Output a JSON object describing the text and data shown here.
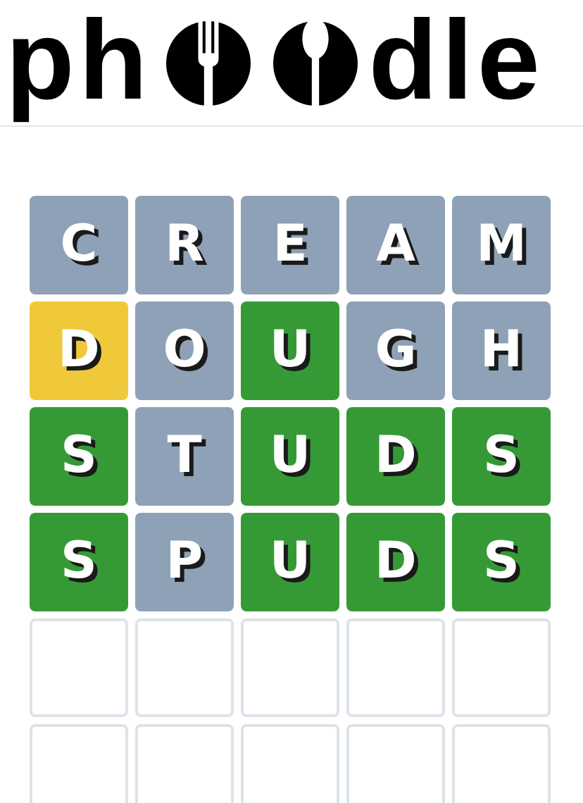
{
  "logo": {
    "prefix": "ph",
    "suffix": "dle"
  },
  "board": [
    [
      {
        "letter": "C",
        "filled": true,
        "color": "#8ea1b6"
      },
      {
        "letter": "R",
        "filled": true,
        "color": "#8ea1b6"
      },
      {
        "letter": "E",
        "filled": true,
        "color": "#8ea1b6"
      },
      {
        "letter": "A",
        "filled": true,
        "color": "#8ea1b6"
      },
      {
        "letter": "M",
        "filled": true,
        "color": "#8ea1b6"
      }
    ],
    [
      {
        "letter": "D",
        "filled": true,
        "color": "#efc93a"
      },
      {
        "letter": "O",
        "filled": true,
        "color": "#8ea1b6"
      },
      {
        "letter": "U",
        "filled": true,
        "color": "#359a36"
      },
      {
        "letter": "G",
        "filled": true,
        "color": "#8ea1b6"
      },
      {
        "letter": "H",
        "filled": true,
        "color": "#8ea1b6"
      }
    ],
    [
      {
        "letter": "S",
        "filled": true,
        "color": "#359a36"
      },
      {
        "letter": "T",
        "filled": true,
        "color": "#8ea1b6"
      },
      {
        "letter": "U",
        "filled": true,
        "color": "#359a36"
      },
      {
        "letter": "D",
        "filled": true,
        "color": "#359a36"
      },
      {
        "letter": "S",
        "filled": true,
        "color": "#359a36"
      }
    ],
    [
      {
        "letter": "S",
        "filled": true,
        "color": "#359a36"
      },
      {
        "letter": "P",
        "filled": true,
        "color": "#8ea1b6"
      },
      {
        "letter": "U",
        "filled": true,
        "color": "#359a36"
      },
      {
        "letter": "D",
        "filled": true,
        "color": "#359a36"
      },
      {
        "letter": "S",
        "filled": true,
        "color": "#359a36"
      }
    ],
    [
      {
        "filled": false
      },
      {
        "filled": false
      },
      {
        "filled": false
      },
      {
        "filled": false
      },
      {
        "filled": false
      }
    ],
    [
      {
        "filled": false
      },
      {
        "filled": false
      },
      {
        "filled": false
      },
      {
        "filled": false
      },
      {
        "filled": false
      }
    ]
  ]
}
